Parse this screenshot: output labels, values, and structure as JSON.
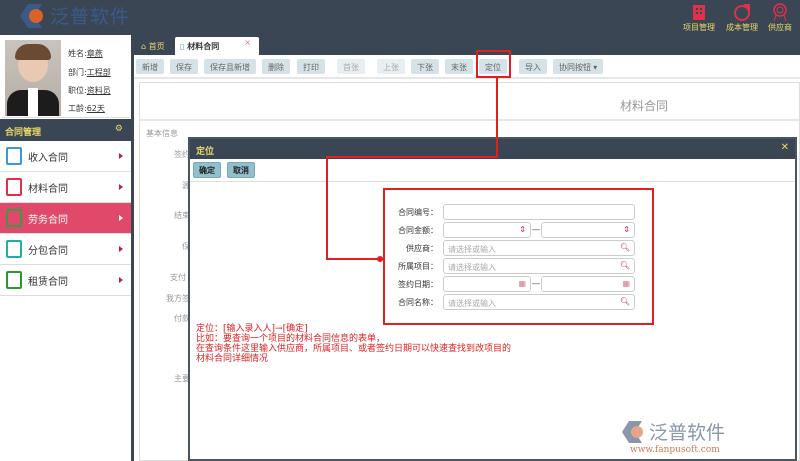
{
  "header": {
    "brand": "泛普软件",
    "nav": [
      {
        "label": "项目管理",
        "icon": "building-icon"
      },
      {
        "label": "成本管理",
        "icon": "pie-chart-icon"
      },
      {
        "label": "供应商",
        "icon": "award-icon"
      }
    ]
  },
  "user": {
    "name_label": "姓名:",
    "name": "章燕",
    "dept_label": "部门:",
    "dept": "工程部",
    "role_label": "职位:",
    "role": "资料员",
    "tenure_label": "工龄:",
    "tenure": "62天"
  },
  "sidebar": {
    "section": "合同管理",
    "items": [
      {
        "label": "收入合同"
      },
      {
        "label": "材料合同"
      },
      {
        "label": "劳务合同",
        "active": true
      },
      {
        "label": "分包合同"
      },
      {
        "label": "租赁合同"
      }
    ]
  },
  "tabs": [
    {
      "label": "首页"
    },
    {
      "label": "材料合同"
    }
  ],
  "toolbar": [
    "新增",
    "保存",
    "保存且新增",
    "删除",
    "打印",
    "首张",
    "上张",
    "下张",
    "末张",
    "定位",
    "导入",
    "协同按钮"
  ],
  "doc": {
    "title": "材料合同",
    "section": "基本信息",
    "labels": [
      "签约",
      "源",
      "结束",
      "保",
      "支付",
      "我方签",
      "付款",
      "主要"
    ]
  },
  "dialog": {
    "title": "定位",
    "ok": "确定",
    "cancel": "取消",
    "fields": {
      "contract_no": "合同编号：",
      "amount": "合同金额：",
      "supplier": "供应商：",
      "project": "所属项目：",
      "sign_date": "签约日期：",
      "contract_name": "合同名称："
    },
    "placeholder": "请选择或输入"
  },
  "annotation": [
    "定位：[输入录入人]→[确定]",
    "比如：要查询一个项目的材料合同信息的表单，",
    "在查询条件这里输入供应商，所属项目、或者签约日期可以快速查找到改项目的",
    "材料合同详细情况"
  ],
  "watermark": {
    "brand": "泛普软件",
    "url": "www.fanpusoft.com"
  }
}
